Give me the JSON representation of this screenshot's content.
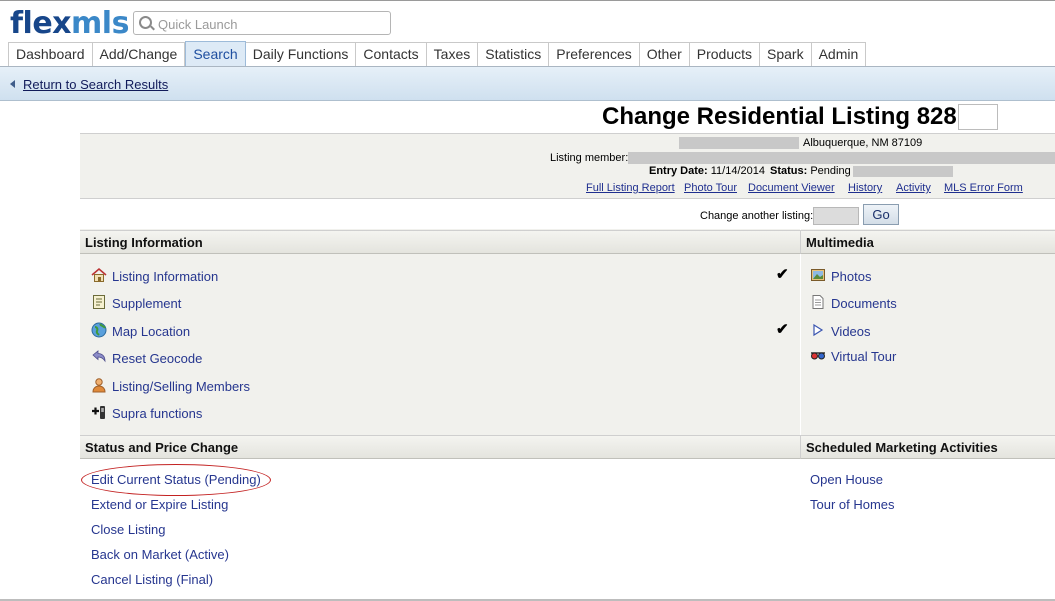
{
  "brand": {
    "flex": "flex",
    "mls": "mls"
  },
  "search": {
    "placeholder": "Quick Launch"
  },
  "nav": {
    "tabs": [
      "Dashboard",
      "Add/Change",
      "Search",
      "Daily Functions",
      "Contacts",
      "Taxes",
      "Statistics",
      "Preferences",
      "Other",
      "Products",
      "Spark",
      "Admin"
    ],
    "active": "Search"
  },
  "breadcrumb": {
    "label": "Return to Search Results"
  },
  "page": {
    "title": "Change Residential Listing 828"
  },
  "listing": {
    "address": "Albuquerque, NM 87109",
    "member_label": "Listing member:",
    "entry_date_label": "Entry Date:",
    "entry_date": "11/14/2014",
    "status_label": "Status:",
    "status": "Pending",
    "links": [
      "Full Listing Report",
      "Photo Tour",
      "Document Viewer",
      "History",
      "Activity",
      "MLS Error Form"
    ]
  },
  "change_another": {
    "label": "Change another listing:",
    "go": "Go"
  },
  "sections": {
    "listing_info": {
      "heading": "Listing Information",
      "items": [
        {
          "label": "Listing Information",
          "icon": "house-icon",
          "checked": true
        },
        {
          "label": "Supplement",
          "icon": "note-icon",
          "checked": false
        },
        {
          "label": "Map Location",
          "icon": "globe-icon",
          "checked": true
        },
        {
          "label": "Reset Geocode",
          "icon": "reset-arrow-icon",
          "checked": false
        },
        {
          "label": "Listing/Selling Members",
          "icon": "person-icon",
          "checked": false
        },
        {
          "label": "Supra functions",
          "icon": "supra-key-icon",
          "checked": false
        }
      ]
    },
    "multimedia": {
      "heading": "Multimedia",
      "items": [
        {
          "label": "Photos",
          "icon": "photo-icon"
        },
        {
          "label": "Documents",
          "icon": "document-icon"
        },
        {
          "label": "Videos",
          "icon": "play-icon"
        },
        {
          "label": "Virtual Tour",
          "icon": "3d-glasses-icon"
        }
      ]
    },
    "status_price": {
      "heading": "Status and Price Change",
      "items": [
        "Edit Current Status (Pending)",
        "Extend or Expire Listing",
        "Close Listing",
        "Back on Market (Active)",
        "Cancel Listing (Final)"
      ]
    },
    "marketing": {
      "heading": "Scheduled Marketing Activities",
      "items": [
        "Open House",
        "Tour of Homes"
      ]
    }
  },
  "check_mark": "✔"
}
